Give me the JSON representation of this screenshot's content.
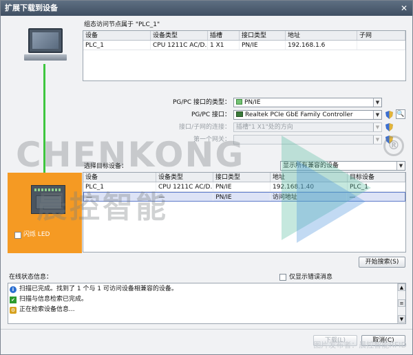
{
  "window": {
    "title": "扩展下载到设备",
    "close_glyph": "✕"
  },
  "target_node": {
    "caption": "组态访问节点属于 \"PLC_1\"",
    "headers": [
      "设备",
      "设备类型",
      "插槽",
      "接口类型",
      "地址",
      "子网"
    ],
    "rows": [
      [
        "PLC_1",
        "CPU 1211C AC/D...",
        "1 X1",
        "PN/IE",
        "192.168.1.6",
        ""
      ]
    ]
  },
  "interface": {
    "type_label": "PG/PC 接口的类型：",
    "type_value": "PN/IE",
    "iface_label": "PG/PC 接口：",
    "iface_value": "Realtek PCIe GbE Family Controller",
    "conn_label": "接口/子网的连接：",
    "conn_value": "插槽\"1 X1\"处的方向",
    "gateway_label": "第一个网关：",
    "gateway_value": "",
    "diag_glyph": "🔍"
  },
  "target_select": {
    "label": "选择目标设备：",
    "filter_value": "显示所有兼容的设备",
    "headers": [
      "设备",
      "设备类型",
      "接口类型",
      "地址",
      "目标设备"
    ],
    "rows": [
      [
        "PLC_1",
        "CPU 1211C AC/D...",
        "PN/IE",
        "192.168.1.40",
        "PLC_1"
      ],
      [
        "—",
        "—",
        "PN/IE",
        "访问地址",
        "—"
      ]
    ]
  },
  "led": {
    "label": "闪烁 LED"
  },
  "buttons": {
    "start_search": "开始搜索(S)",
    "load": "下载(L)",
    "cancel": "取消(C)"
  },
  "status": {
    "title": "在线状态信息：",
    "only_errors_label": "仅显示错误消息",
    "lines": [
      {
        "icon": "info-icon",
        "glyph": "i",
        "text": "扫描已完成。找到了 1 个与 1 可访问设备相兼容的设备。"
      },
      {
        "icon": "check-icon",
        "glyph": "✔",
        "text": "扫描与信息检索已完成。"
      },
      {
        "icon": "busy-icon",
        "glyph": "⚙",
        "text": "正在检索设备信息..."
      }
    ],
    "scroll_up": "▲",
    "scroll_mid": "≡",
    "scroll_down": "▼"
  },
  "watermark": {
    "text_en": "CHENKONG",
    "text_cn": "晨控智能",
    "reg": "®"
  },
  "credit": "图片发布者：晨控智能RFID"
}
